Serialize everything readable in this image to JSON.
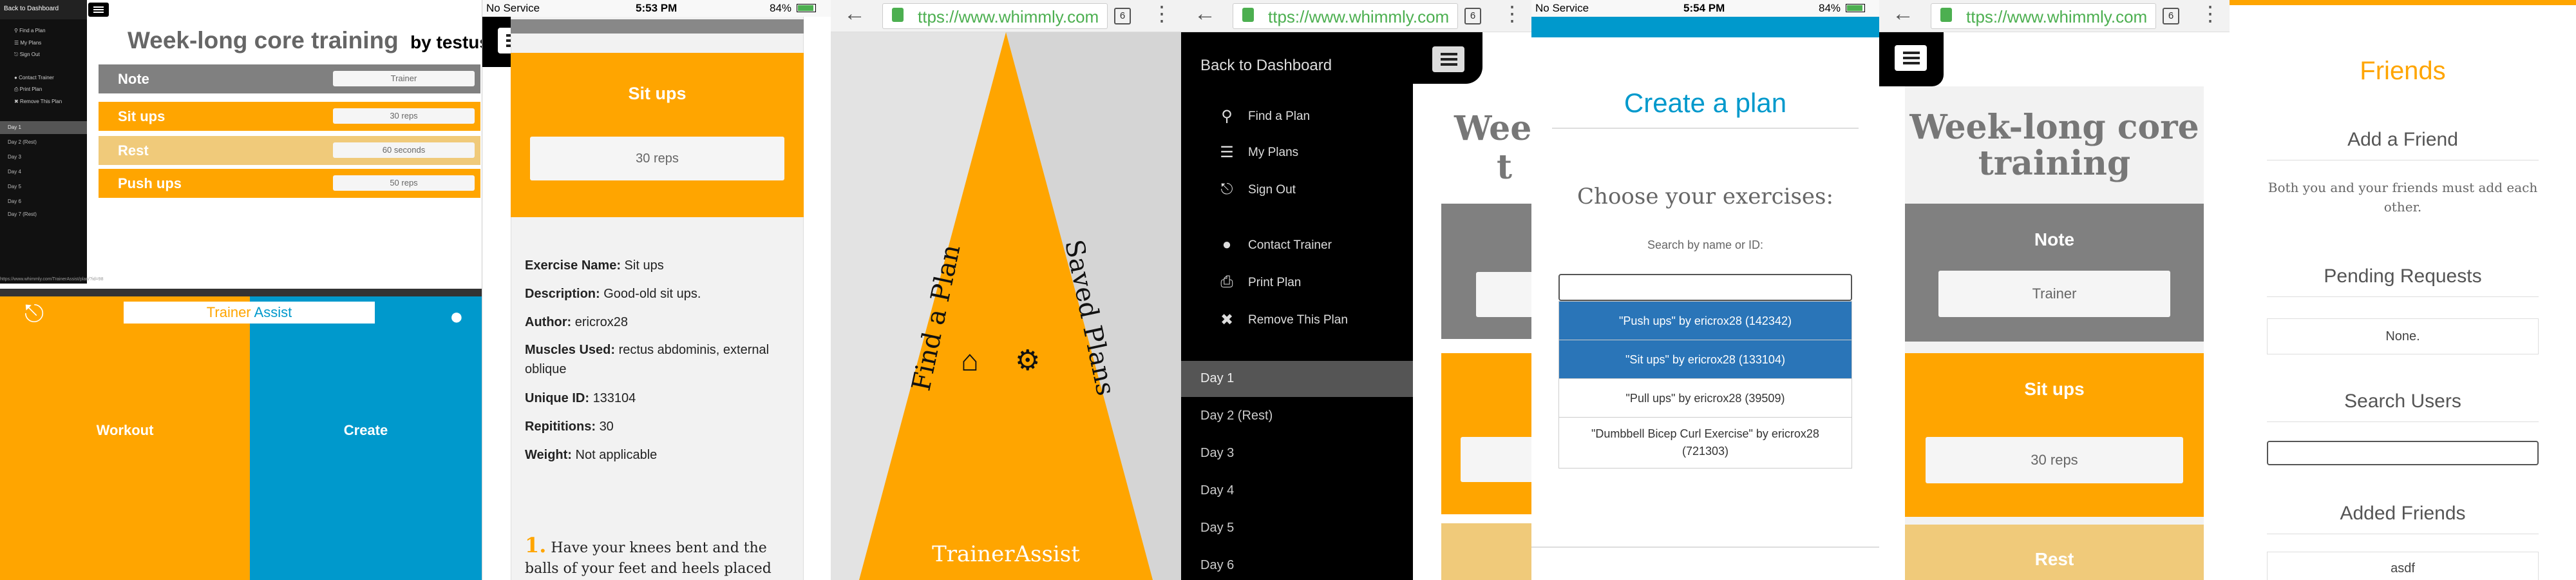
{
  "p1": {
    "sidebar": {
      "back": "Back to Dashboard",
      "items": [
        "Find a Plan",
        "My Plans",
        "Sign Out"
      ],
      "items2": [
        "Contact Trainer",
        "Print Plan",
        "Remove This Plan"
      ],
      "days": [
        "Day 1",
        "Day 2 (Rest)",
        "Day 3",
        "Day 4",
        "Day 5",
        "Day 6",
        "Day 7 (Rest)"
      ]
    },
    "title": "Week-long core training",
    "byline": "by testuser",
    "rows": [
      {
        "label": "Note",
        "value": "Trainer",
        "color": "#808080"
      },
      {
        "label": "Sit ups",
        "value": "30 reps",
        "color": "#ffa500"
      },
      {
        "label": "Rest",
        "value": "60 seconds",
        "color": "#f0ca7a"
      },
      {
        "label": "Push ups",
        "value": "50 reps",
        "color": "#ffa500"
      }
    ],
    "url": "https://www.whimmly.com/TrainerAssist/plan/?id=98"
  },
  "p2": {
    "brand_a": "Trainer",
    "brand_b": "Assist",
    "workout": "Workout",
    "create": "Create",
    "tab": "TrainerAssist"
  },
  "p3": {
    "status": {
      "carrier": "No Service",
      "time": "5:53 PM",
      "battery": "84%"
    },
    "card_title": "Sit ups",
    "card_value": "30 reps",
    "details": [
      {
        "k": "Exercise Name:",
        "v": "Sit ups"
      },
      {
        "k": "Description:",
        "v": "Good-old sit ups."
      },
      {
        "k": "Author:",
        "v": "ericrox28"
      },
      {
        "k": "Muscles Used:",
        "v": "rectus abdominis, external oblique"
      },
      {
        "k": "Unique ID:",
        "v": "133104"
      },
      {
        "k": "Repititions:",
        "v": "30"
      },
      {
        "k": "Weight:",
        "v": "Not applicable"
      }
    ],
    "step_num": "1.",
    "step_text": "Have your knees bent and the balls of your feet and heels placed flat on the"
  },
  "p4": {
    "url_prefix": "ttps://www.whimmly.com",
    "tabs": "6",
    "left_label": "Find a Plan",
    "right_label": "Saved Plans",
    "brand": "TrainerAssist"
  },
  "p5": {
    "url_prefix": "ttps://www.whimmly.com",
    "tabs": "6",
    "back": "Back to Dashboard",
    "items": [
      {
        "icon": "search-icon",
        "glyph": "⚲",
        "label": "Find a Plan"
      },
      {
        "icon": "list-icon",
        "glyph": "☰",
        "label": "My Plans"
      },
      {
        "icon": "sign-out-icon",
        "glyph": "⎋",
        "label": "Sign Out"
      },
      {
        "icon": "user-icon",
        "glyph": "●",
        "label": "Contact Trainer"
      },
      {
        "icon": "print-icon",
        "glyph": "⎙",
        "label": "Print Plan"
      },
      {
        "icon": "close-icon",
        "glyph": "✖",
        "label": "Remove This Plan"
      }
    ],
    "days": [
      "Day 1",
      "Day 2 (Rest)",
      "Day 3",
      "Day 4",
      "Day 5",
      "Day 6"
    ],
    "behind_title": "Wee t"
  },
  "p6": {
    "status": {
      "carrier": "No Service",
      "time": "5:54 PM",
      "battery": "84%"
    },
    "title": "Create a plan",
    "subtitle": "Choose your exercises:",
    "search_label": "Search by name or ID:",
    "results": [
      "\"Push ups\" by ericrox28 (142342)",
      "\"Sit ups\" by ericrox28 (133104)",
      "\"Pull ups\" by ericrox28 (39509)",
      "\"Dumbbell Bicep Curl Exercise\" by ericrox28 (721303)"
    ]
  },
  "p7": {
    "url_prefix": "ttps://www.whimmly.com",
    "tabs": "6",
    "title": "Week-long core training",
    "note_label": "Note",
    "note_value": "Trainer",
    "situps_label": "Sit ups",
    "situps_value": "30 reps",
    "rest_label": "Rest"
  },
  "p8": {
    "title": "Friends",
    "add_heading": "Add a Friend",
    "add_desc": "Both you and your friends must add each other.",
    "pending_heading": "Pending Requests",
    "pending_value": "None.",
    "search_heading": "Search Users",
    "added_heading": "Added Friends",
    "added_value": "asdf"
  }
}
